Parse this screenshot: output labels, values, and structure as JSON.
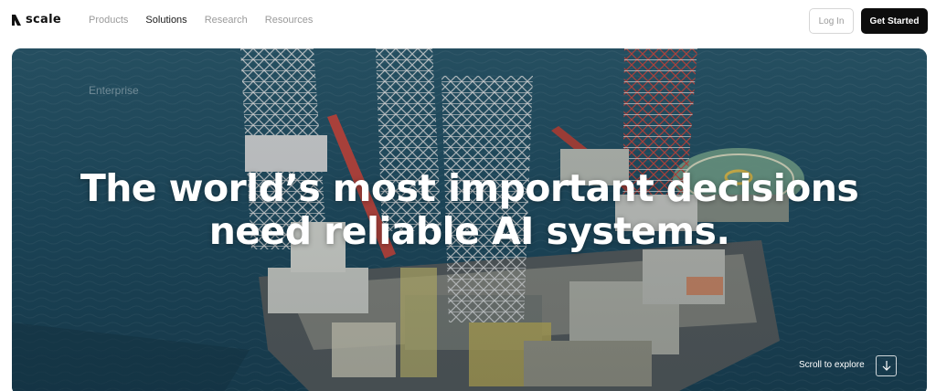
{
  "brand": {
    "name": "scale",
    "logo_icon": "scale-logo-icon"
  },
  "nav": {
    "items": [
      {
        "label": "Products",
        "active": false
      },
      {
        "label": "Solutions",
        "active": true
      },
      {
        "label": "Research",
        "active": false
      },
      {
        "label": "Resources",
        "active": false
      }
    ]
  },
  "header_actions": {
    "login_label": "Log In",
    "cta_label": "Get Started"
  },
  "hero": {
    "eyebrow": "Enterprise",
    "headline_line1": "The world’s most important decisions",
    "headline_line2": "need reliable AI systems.",
    "scroll_label": "Scroll to explore",
    "scroll_icon": "arrow-down-icon"
  },
  "colors": {
    "accent_dark": "#0d0d0d",
    "nav_muted": "#9a9a9a",
    "nav_active": "#1a1a1a",
    "sea": "#1f4a5e"
  }
}
